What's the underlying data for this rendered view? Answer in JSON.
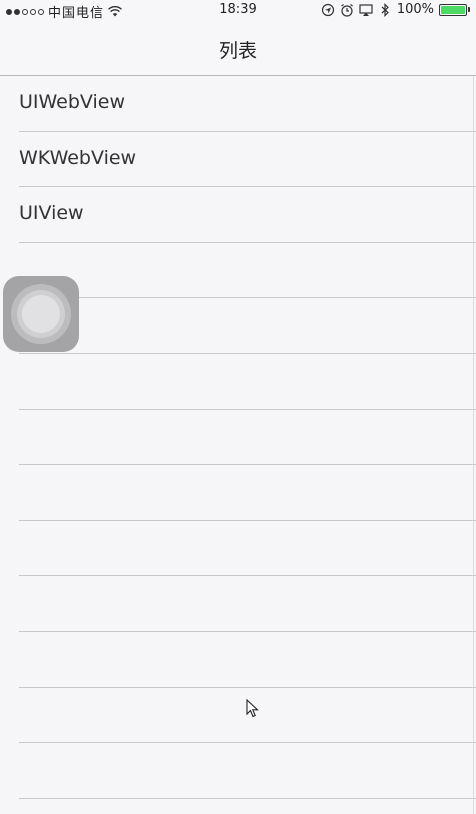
{
  "status_bar": {
    "carrier": "中国电信",
    "time": "18:39",
    "battery_percent_label": "100%",
    "battery_level": 1.0,
    "icons": [
      "signal-dots-icon",
      "wifi-icon",
      "location-icon",
      "alarm-icon",
      "airplay-icon",
      "bluetooth-icon",
      "battery-icon"
    ],
    "battery_color": "#4cd964"
  },
  "nav": {
    "title": "列表"
  },
  "list": {
    "items": [
      {
        "label": "UIWebView"
      },
      {
        "label": "WKWebView"
      },
      {
        "label": "UIView"
      },
      {
        "label": ""
      },
      {
        "label": ""
      },
      {
        "label": ""
      },
      {
        "label": ""
      },
      {
        "label": ""
      },
      {
        "label": ""
      },
      {
        "label": ""
      },
      {
        "label": ""
      },
      {
        "label": ""
      },
      {
        "label": ""
      }
    ]
  },
  "overlay": {
    "assistive_touch_icon": "assistive-touch-icon",
    "cursor_icon": "mouse-pointer-icon"
  }
}
